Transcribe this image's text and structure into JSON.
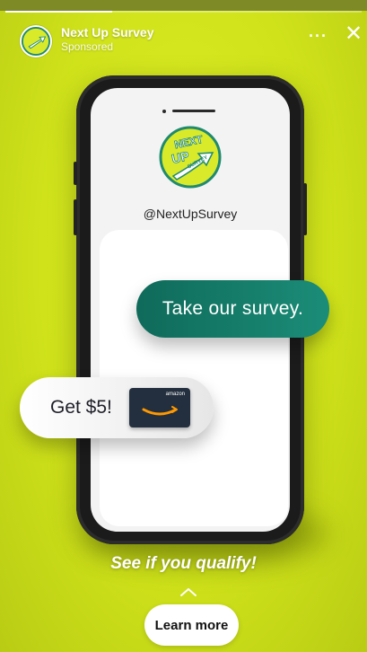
{
  "header": {
    "account_name": "Next Up Survey",
    "account_sub": "Sponsored",
    "more_label": "···",
    "close_label": "✕"
  },
  "progress": {
    "fraction": 0.3
  },
  "ad": {
    "logo_text": [
      "NEXT",
      "UP",
      "SURVEY"
    ],
    "handle": "@NextUpSurvey",
    "survey_pill": "Take our survey.",
    "cash_pill": "Get $5!",
    "giftcard_brand": "amazon",
    "qualify_text": "See if you qualify!"
  },
  "cta": {
    "label": "Learn more"
  },
  "colors": {
    "background": "#d3e61c",
    "survey_pill": "#1b8d78",
    "giftcard": "#232f3e",
    "amazon_smile": "#ff9900"
  },
  "icons": [
    "brand-logo-icon",
    "more-icon",
    "close-icon",
    "amazon-smile-icon",
    "chevron-up-icon"
  ]
}
